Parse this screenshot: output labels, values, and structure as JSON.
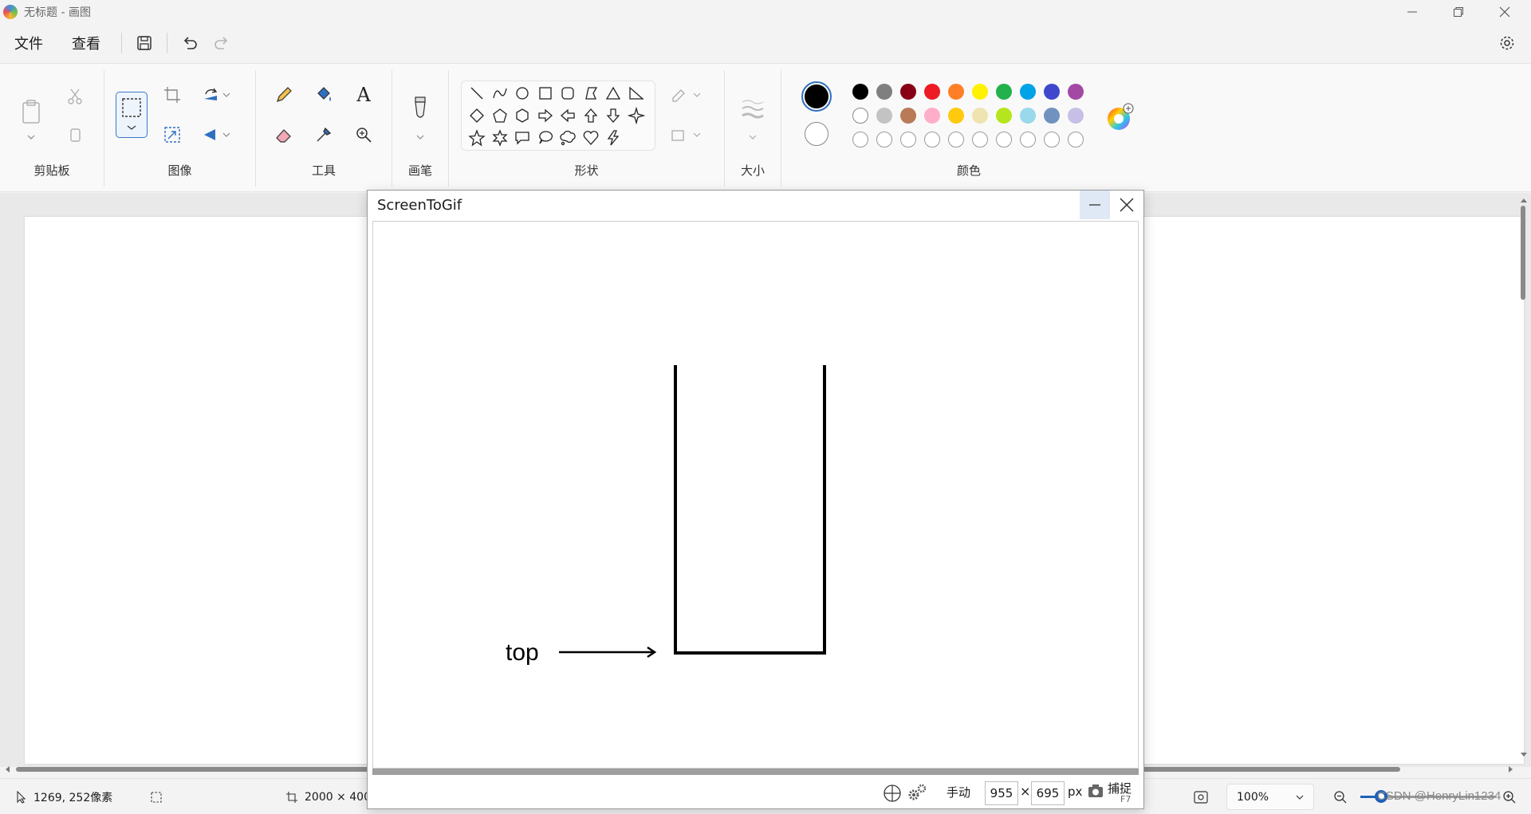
{
  "window": {
    "title": "无标题 - 画图"
  },
  "menu": {
    "file": "文件",
    "view": "查看"
  },
  "ribbon": {
    "clipboard_label": "剪贴板",
    "image_label": "图像",
    "tools_label": "工具",
    "brushes_label": "画笔",
    "shapes_label": "形状",
    "size_label": "大小",
    "colors_label": "颜色",
    "text_tool_glyph": "A"
  },
  "colors": {
    "primary": "#000000",
    "secondary": "#ffffff",
    "palette_row1": [
      "#000000",
      "#7f7f7f",
      "#880015",
      "#ed1c24",
      "#ff7f27",
      "#fff200",
      "#22b14c",
      "#00a2e8",
      "#3f48cc",
      "#a349a4"
    ],
    "palette_row2": [
      "#ffffff",
      "#c3c3c3",
      "#b97a57",
      "#ffaec9",
      "#ffc90e",
      "#efe4b0",
      "#b5e61d",
      "#99d9ea",
      "#7092be",
      "#c8bfe7"
    ]
  },
  "status": {
    "cursor_pos": "1269, 252像素",
    "canvas_size": "2000 × 400",
    "zoom": "100%"
  },
  "screentogif": {
    "title": "ScreenToGif",
    "drawing_label": "top",
    "mode": "手动",
    "width": "955",
    "times": "×",
    "height": "695",
    "unit": "px",
    "capture": "捕捉",
    "capture_key": "F7"
  },
  "watermark": "CSDN @HenryLin1234"
}
